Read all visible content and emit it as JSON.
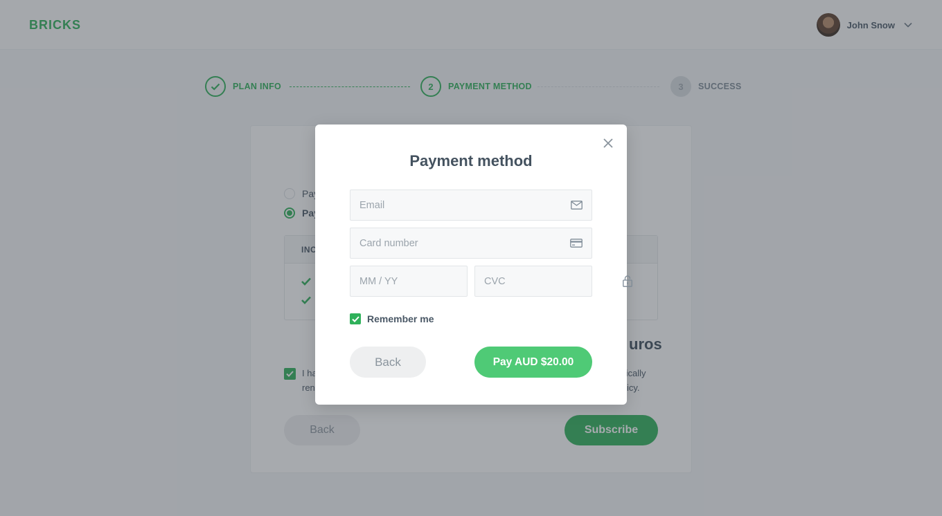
{
  "app": {
    "logo": "BRICKS"
  },
  "user": {
    "name": "John Snow"
  },
  "stepper": {
    "steps": [
      {
        "number": "",
        "label": "PLAN INFO",
        "state": "done"
      },
      {
        "number": "2",
        "label": "PAYMENT METHOD",
        "state": "active"
      },
      {
        "number": "3",
        "label": "SUCCESS",
        "state": "pending"
      }
    ]
  },
  "background_card": {
    "radio_1": "Pay",
    "radio_2": "Pay",
    "included_header": "INC",
    "price_fragment": "uros",
    "terms_line1_left": "I ha",
    "terms_line2_left": "ren",
    "terms_line1_right": "tically",
    "terms_line2_right": "icy.",
    "back_label": "Back",
    "subscribe_label": "Subscribe"
  },
  "modal": {
    "title": "Payment method",
    "email_placeholder": "Email",
    "card_placeholder": "Card number",
    "expiry_placeholder": "MM / YY",
    "cvc_placeholder": "CVC",
    "remember_label": "Remember me",
    "remember_checked": true,
    "back_label": "Back",
    "pay_label": "Pay AUD $20.00"
  },
  "colors": {
    "accent": "#2fb15a",
    "pay_button": "#4fca76",
    "text": "#44525f"
  }
}
